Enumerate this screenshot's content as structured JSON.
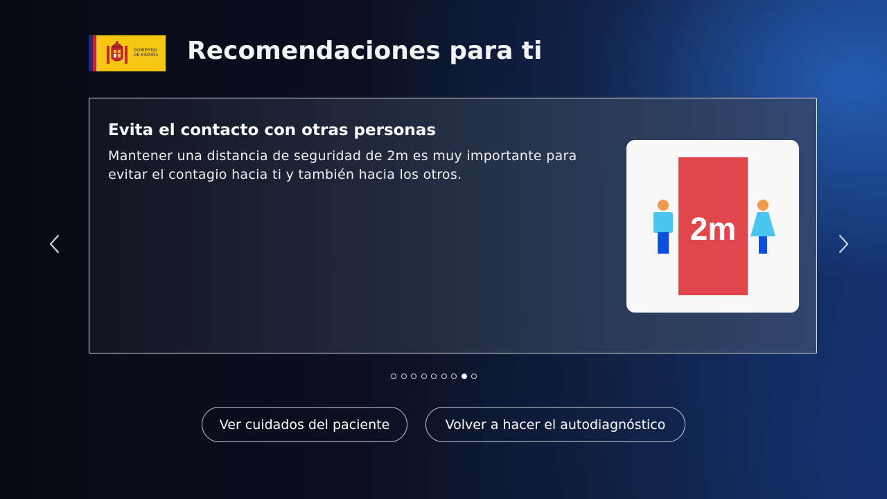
{
  "header": {
    "logo_text": "GOBIERNO\nDE ESPAÑA",
    "title": "Recomendaciones para ti"
  },
  "carousel": {
    "card": {
      "title": "Evita el contacto con otras personas",
      "text": "Mantener una distancia de seguridad de 2m es muy importante para evitar el contagio hacia ti y también hacia los otros.",
      "illustration_label": "2m"
    },
    "dots_total": 9,
    "active_dot": 8
  },
  "buttons": {
    "patient_care": "Ver cuidados del paciente",
    "redo_selftest": "Volver a hacer el autodiagnóstico"
  },
  "colors": {
    "distance_red": "#e0464b",
    "person_light_blue": "#4cc4f0",
    "person_dark_blue": "#0a4fe0",
    "skin_orange": "#f19a4e",
    "logo_yellow": "#f7c713"
  }
}
